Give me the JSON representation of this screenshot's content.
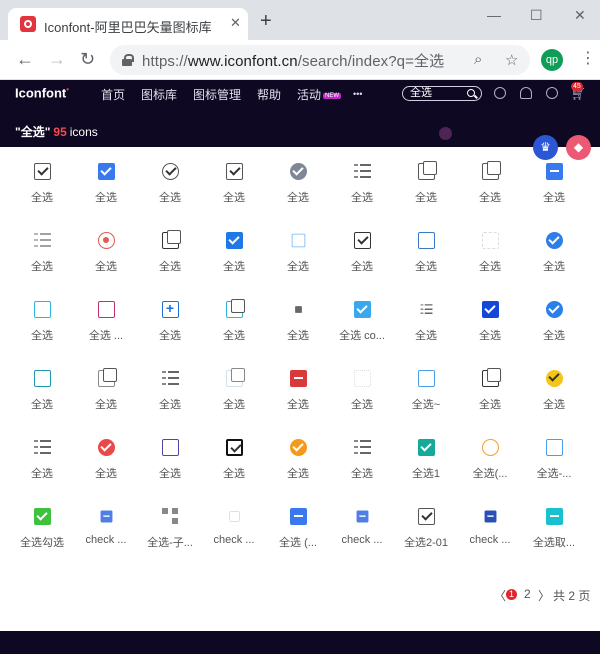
{
  "browser": {
    "tab_title": "Iconfont-阿里巴巴矢量图标库",
    "tab_close": "✕",
    "new_tab": "+",
    "window_controls": [
      "—",
      "☐",
      "✕"
    ],
    "back": "←",
    "forward": "→",
    "reload": "↻",
    "url_prefix": "https://",
    "url_host": "www.iconfont.cn",
    "url_path": "/search/index?q=全选",
    "profile_initials": "qp",
    "menu": "⋮"
  },
  "site": {
    "logo": "Iconfont",
    "nav": [
      "首页",
      "图标库",
      "图标管理",
      "帮助",
      "活动"
    ],
    "nav_new_badge": "NEW",
    "more": "•••",
    "search_value": "全选",
    "cart_count": "45",
    "result_label": "\"全选\"",
    "result_count": "95",
    "result_unit": "icons"
  },
  "colors": {
    "header_bg": "#0e0822",
    "accent_red": "#e0252c",
    "crown_bg": "#2b56d4",
    "paint_bg": "#ea5a73"
  },
  "icons": [
    {
      "name": "全选",
      "icon": "checkbox-outline-icon"
    },
    {
      "name": "全选",
      "icon": "checkbox-blue-stack-icon"
    },
    {
      "name": "全选",
      "icon": "check-circle-outline-icon"
    },
    {
      "name": "全选",
      "icon": "checkbox-outline-icon"
    },
    {
      "name": "全选",
      "icon": "check-circle-grey-icon"
    },
    {
      "name": "全选",
      "icon": "checklist-icon"
    },
    {
      "name": "全选",
      "icon": "checkbox-stack-icon"
    },
    {
      "name": "全选",
      "icon": "checkbox-stack-icon"
    },
    {
      "name": "全选",
      "icon": "minus-square-blue-icon"
    },
    {
      "name": "全选",
      "icon": "checklist-light-icon"
    },
    {
      "name": "全选",
      "icon": "radio-dot-red-icon"
    },
    {
      "name": "全选",
      "icon": "checkbox-stack-dark-icon"
    },
    {
      "name": "全选",
      "icon": "checkbox-blue-filled-icon"
    },
    {
      "name": "全选",
      "icon": "checkbox-light-blue-icon"
    },
    {
      "name": "全选",
      "icon": "checkbox-red-check-icon"
    },
    {
      "name": "全选",
      "icon": "checkbox-blue-outline-icon"
    },
    {
      "name": "全选",
      "icon": "checkbox-faint-icon"
    },
    {
      "name": "全选",
      "icon": "check-circle-blue-icon"
    },
    {
      "name": "全选",
      "icon": "checkbox-cyan-icon"
    },
    {
      "name": "全选 ...",
      "icon": "checkbox-red-mark-icon"
    },
    {
      "name": "全选",
      "icon": "plus-square-blue-icon"
    },
    {
      "name": "全选",
      "icon": "checkbox-cyan-stack-icon"
    },
    {
      "name": "全选",
      "icon": "tiny-check-icon"
    },
    {
      "name": "全选 co...",
      "icon": "checkbox-sky-filled-icon"
    },
    {
      "name": "全选",
      "icon": "checklist-small-icon"
    },
    {
      "name": "全选",
      "icon": "checkbox-navy-filled-icon"
    },
    {
      "name": "全选",
      "icon": "check-circle-blue-icon"
    },
    {
      "name": "全选",
      "icon": "checkbox-teal-icon"
    },
    {
      "name": "全选",
      "icon": "checkbox-stack-grey-icon"
    },
    {
      "name": "全选",
      "icon": "checklist-blue-icon"
    },
    {
      "name": "全选",
      "icon": "checkbox-pale-icon"
    },
    {
      "name": "全选",
      "icon": "minus-square-red-icon"
    },
    {
      "name": "全选",
      "icon": "dotted-square-icon"
    },
    {
      "name": "全选~",
      "icon": "checkbox-sky-outline-icon"
    },
    {
      "name": "全选",
      "icon": "checkbox-stack-dark-icon"
    },
    {
      "name": "全选",
      "icon": "check-circle-yellow-icon"
    },
    {
      "name": "全选",
      "icon": "checklist-icon"
    },
    {
      "name": "全选",
      "icon": "check-circle-red-icon"
    },
    {
      "name": "全选",
      "icon": "checkbox-indigo-icon"
    },
    {
      "name": "全选",
      "icon": "checkbox-black-stack-icon"
    },
    {
      "name": "全选",
      "icon": "check-circle-orange-icon"
    },
    {
      "name": "全选",
      "icon": "checklist-icon"
    },
    {
      "name": "全选1",
      "icon": "checkbox-teal-filled-icon"
    },
    {
      "name": "全选(...",
      "icon": "check-circle-orange-outline-icon"
    },
    {
      "name": "全选-...",
      "icon": "checkbox-sky-outline-icon"
    },
    {
      "name": "全选勾选",
      "icon": "checkbox-green-filled-icon"
    },
    {
      "name": "check ...",
      "icon": "minus-square-small-blue-icon"
    },
    {
      "name": "全选-子...",
      "icon": "tree-nodes-icon"
    },
    {
      "name": "check ...",
      "icon": "faint-square-icon"
    },
    {
      "name": "全选 (...",
      "icon": "minus-square-blue-icon"
    },
    {
      "name": "check ...",
      "icon": "minus-square-small-blue-icon"
    },
    {
      "name": "全选2-01",
      "icon": "checkbox-outline-icon"
    },
    {
      "name": "check ...",
      "icon": "minus-square-navy-icon"
    },
    {
      "name": "全选取...",
      "icon": "minus-square-cyan-icon"
    }
  ],
  "pagination": {
    "prev": "〈",
    "current": "1",
    "next_page": "2",
    "next": "〉",
    "total": "共 2 页"
  }
}
